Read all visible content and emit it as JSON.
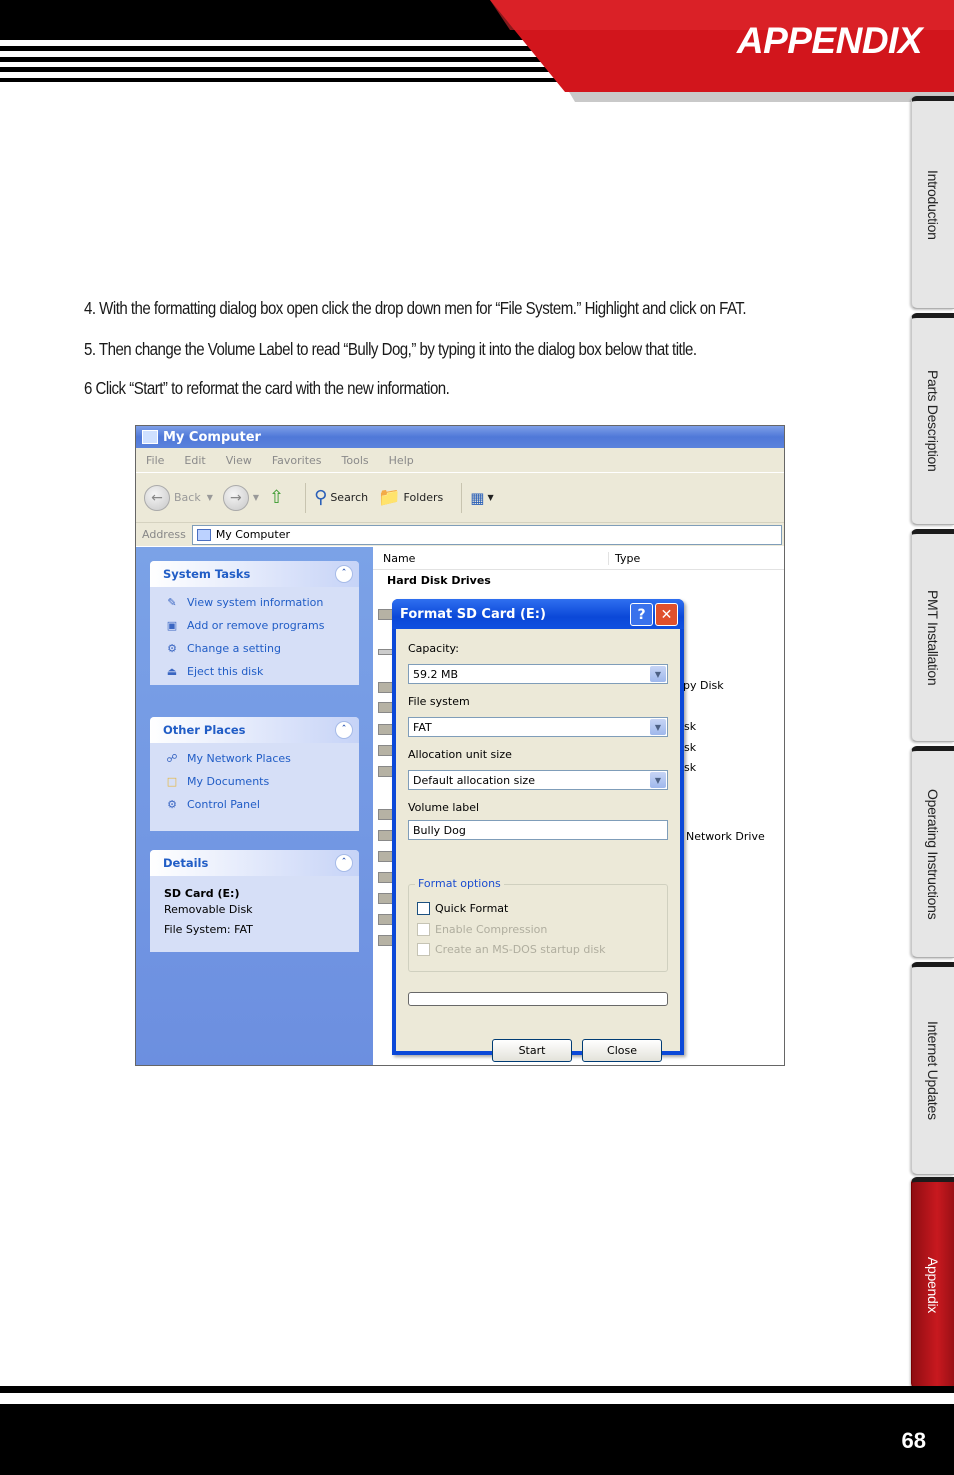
{
  "header": {
    "section_title": "APPENDIX"
  },
  "tabs": [
    {
      "label": "Introduction",
      "active": false
    },
    {
      "label": "Parts Description",
      "active": false
    },
    {
      "label": "PMT Installation",
      "active": false
    },
    {
      "label": "Operating Instructions",
      "active": false
    },
    {
      "label": "Internet Updates",
      "active": false
    },
    {
      "label": "Appendix",
      "active": true
    }
  ],
  "steps": [
    "4. With the formatting dialog box open click the drop down men for “File System.” Highlight and click on FAT.",
    "5. Then change the Volume Label to read “Bully Dog,” by typing it into the dialog box below that title.",
    "6 Click “Start” to reformat the card with the new information."
  ],
  "screenshot": {
    "window_title": "My Computer",
    "menu": [
      "File",
      "Edit",
      "View",
      "Favorites",
      "Tools",
      "Help"
    ],
    "toolbar": {
      "back": "Back",
      "search": "Search",
      "folders": "Folders"
    },
    "address_label": "Address",
    "address_value": "My Computer",
    "system_tasks": {
      "title": "System Tasks",
      "items": [
        "View system information",
        "Add or remove programs",
        "Change a setting",
        "Eject this disk"
      ]
    },
    "other_places": {
      "title": "Other Places",
      "items": [
        "My Network Places",
        "My Documents",
        "Control Panel"
      ]
    },
    "details": {
      "title": "Details",
      "name": "SD Card (E:)",
      "kind": "Removable Disk",
      "fs": "File System: FAT"
    },
    "columns": {
      "name": "Name",
      "type": "Type"
    },
    "group": "Hard Disk Drives",
    "fragments": {
      "floppy": "py Disk",
      "sk1": "sk",
      "sk2": "sk",
      "sk3": "sk",
      "network": "Network Drive"
    },
    "dialog": {
      "title": "Format SD Card (E:)",
      "help": "?",
      "close": "✕",
      "capacity_label": "Capacity:",
      "capacity_value": "59.2 MB",
      "fs_label": "File system",
      "fs_value": "FAT",
      "alloc_label": "Allocation unit size",
      "alloc_value": "Default allocation size",
      "volume_label": "Volume label",
      "volume_value": "Bully Dog",
      "format_options": "Format options",
      "quick_format": "Quick Format",
      "compression": "Enable Compression",
      "msdos": "Create an MS-DOS startup disk",
      "start": "Start",
      "close_button": "Close"
    }
  },
  "footer": {
    "page_number": "68"
  }
}
